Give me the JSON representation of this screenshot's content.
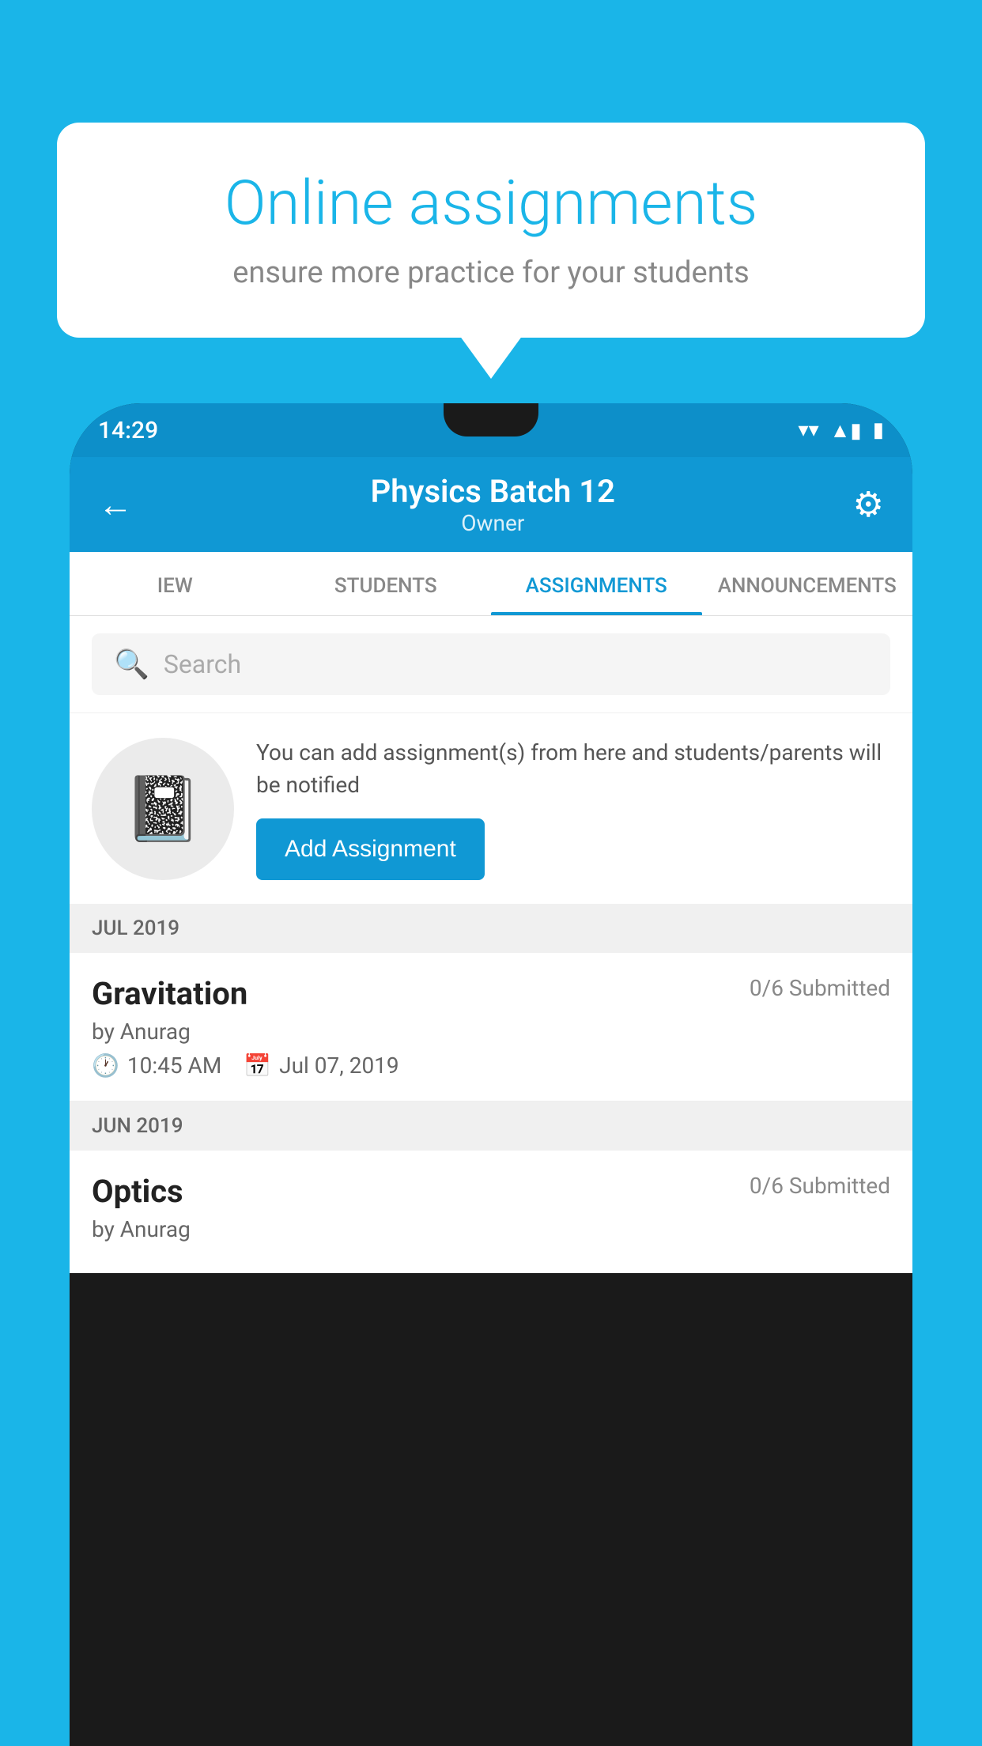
{
  "background_color": "#1ab5e8",
  "speech_bubble": {
    "title": "Online assignments",
    "subtitle": "ensure more practice for your students"
  },
  "status_bar": {
    "time": "14:29",
    "wifi_icon": "▼",
    "signal_icon": "▲",
    "battery_icon": "▮"
  },
  "header": {
    "title": "Physics Batch 12",
    "subtitle": "Owner",
    "back_label": "←",
    "settings_label": "⚙"
  },
  "tabs": [
    {
      "label": "IEW",
      "active": false
    },
    {
      "label": "STUDENTS",
      "active": false
    },
    {
      "label": "ASSIGNMENTS",
      "active": true
    },
    {
      "label": "ANNOUNCEMENTS",
      "active": false
    }
  ],
  "search": {
    "placeholder": "Search"
  },
  "promo": {
    "text": "You can add assignment(s) from here and students/parents will be notified",
    "button_label": "Add Assignment"
  },
  "sections": [
    {
      "month_label": "JUL 2019",
      "assignments": [
        {
          "name": "Gravitation",
          "submitted": "0/6 Submitted",
          "by": "by Anurag",
          "time": "10:45 AM",
          "date": "Jul 07, 2019"
        }
      ]
    },
    {
      "month_label": "JUN 2019",
      "assignments": [
        {
          "name": "Optics",
          "submitted": "0/6 Submitted",
          "by": "by Anurag",
          "time": "",
          "date": ""
        }
      ]
    }
  ]
}
